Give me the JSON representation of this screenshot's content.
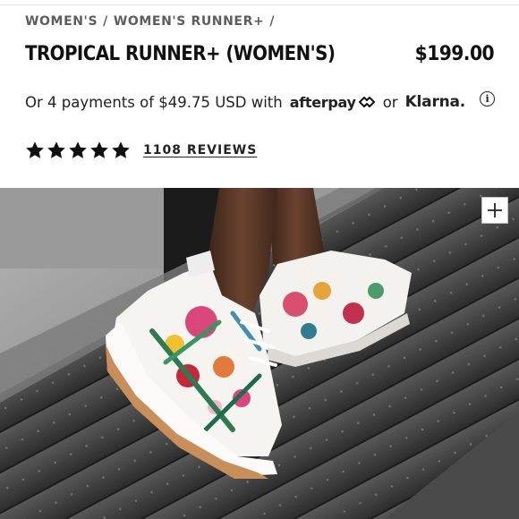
{
  "breadcrumb": {
    "items": [
      "WOMEN'S",
      "WOMEN'S RUNNER+"
    ],
    "separator": "/"
  },
  "product": {
    "title": "TROPICAL RUNNER+ (WOMEN'S)",
    "price": "$199.00"
  },
  "payments": {
    "prefix": "Or 4 payments of $49.75 USD with",
    "afterpay_label": "afterpay",
    "or_text": "or",
    "klarna_label": "Klarna.",
    "info_icon": "info-icon",
    "info_glyph": "i"
  },
  "rating": {
    "stars": 5,
    "max_stars": 5,
    "reviews_label": "1108 REVIEWS"
  },
  "hero": {
    "alt": "Tropical floral print running shoe on treadmill",
    "zoom_icon": "plus-icon"
  },
  "colors": {
    "text": "#111111",
    "muted": "#5d5d5d",
    "gum_sole": "#c98f5a"
  }
}
